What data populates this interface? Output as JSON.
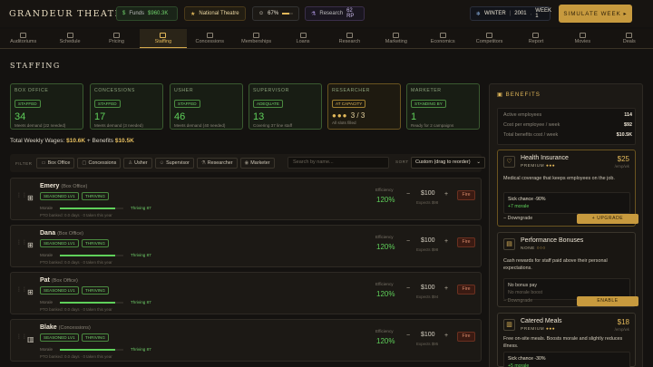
{
  "app": {
    "title": "GRANDEUR THEATRE",
    "simulate_label": "SIMULATE WEEK ▸"
  },
  "topbar": {
    "funds_label": "Funds",
    "funds_value": "$960.3K",
    "theatre_label": "National Theatre",
    "happiness_value": "67%",
    "happiness_level": 0.67,
    "research_label": "Research",
    "research_value": "62 RP",
    "season": "WINTER",
    "year": "2001",
    "week": "WEEK 1"
  },
  "nav": [
    "Auditoriums",
    "Schedule",
    "Pricing",
    "Staffing",
    "Concessions",
    "Memberships",
    "Loans",
    "Research",
    "Marketing",
    "Economics",
    "Competitors",
    "Report",
    "Movies",
    "Deals"
  ],
  "page_title": "STAFFING",
  "cards": [
    {
      "title": "BOX OFFICE",
      "badge": "STAFFED",
      "value": "34",
      "sub": "Meets demand (22 needed)"
    },
    {
      "title": "CONCESSIONS",
      "badge": "STAFFED",
      "value": "17",
      "sub": "Meets demand (3 needed)"
    },
    {
      "title": "USHER",
      "badge": "STAFFED",
      "value": "46",
      "sub": "Meets demand (40 needed)"
    },
    {
      "title": "SUPERVISOR",
      "badge": "ADEQUATE",
      "value": "13",
      "sub": "Covering 37 line staff"
    },
    {
      "title": "RESEARCHER",
      "badge": "AT CAPACITY",
      "value": "3 / 3",
      "sub": "All slots filled"
    },
    {
      "title": "MARKETER",
      "badge": "STANDING BY",
      "value": "1",
      "sub": "Ready for 2 campaigns"
    }
  ],
  "wages": {
    "label": "Total Weekly Wages:",
    "value": "$10.6K",
    "benefits_label": "+ Benefits",
    "benefits_value": "$10.5K"
  },
  "filter": {
    "label": "FILTER",
    "pills": [
      "Box Office",
      "Concessions",
      "Usher",
      "Supervisor",
      "Researcher",
      "Marketer"
    ],
    "search_placeholder": "Search by name...",
    "sort_label": "SORT",
    "sort_value": "Custom (drag to reorder)"
  },
  "staff": [
    {
      "name": "Emery",
      "role": "(Box Office)",
      "level": "SEASONED LV1",
      "mood": "THRIVING",
      "morale_label": "Morale",
      "morale_text": "Thriving 87",
      "morale_level": 0.87,
      "pto": "PTO banked: 0.0 days · 0 taken this year",
      "eff_label": "Efficiency",
      "eff": "120%",
      "pay": "$100",
      "expects": "Expects $98",
      "fire": "Fire"
    },
    {
      "name": "Dana",
      "role": "(Box Office)",
      "level": "SEASONED LV1",
      "mood": "THRIVING",
      "morale_label": "Morale",
      "morale_text": "Thriving 87",
      "morale_level": 0.87,
      "pto": "PTO banked: 0.0 days · 0 taken this year",
      "eff_label": "Efficiency",
      "eff": "120%",
      "pay": "$100",
      "expects": "Expects $98",
      "fire": "Fire"
    },
    {
      "name": "Pat",
      "role": "(Box Office)",
      "level": "SEASONED LV1",
      "mood": "THRIVING",
      "morale_label": "Morale",
      "morale_text": "Thriving 87",
      "morale_level": 0.87,
      "pto": "PTO banked: 0.0 days · 0 taken this year",
      "eff_label": "Efficiency",
      "eff": "120%",
      "pay": "$100",
      "expects": "Expects $94",
      "fire": "Fire"
    },
    {
      "name": "Blake",
      "role": "(Concessions)",
      "level": "SEASONED LV1",
      "mood": "THRIVING",
      "morale_label": "Morale",
      "morale_text": "Thriving 87",
      "morale_level": 0.87,
      "pto": "PTO banked: 0.0 days · 0 taken this year",
      "eff_label": "Efficiency",
      "eff": "120%",
      "pay": "$100",
      "expects": "Expects $95",
      "fire": "Fire"
    }
  ],
  "benefits": {
    "title": "BENEFITS",
    "stats": [
      {
        "label": "Active employees",
        "value": "114"
      },
      {
        "label": "Cost per employee / week",
        "value": "$92"
      },
      {
        "label": "Total benefits cost / week",
        "value": "$10.5K"
      }
    ],
    "items": [
      {
        "name": "Health Insurance",
        "level": "PREMIUM",
        "stars": "●●●",
        "price": "$25",
        "per": "/emp/wk",
        "desc": "Medical coverage that keeps employees on the job.",
        "detail1": "Sick chance -90%",
        "detail2": "+7 morale",
        "down": "− Downgrade",
        "up": "+ UPGRADE"
      },
      {
        "name": "Performance Bonuses",
        "level": "NONE",
        "stars": "○○○",
        "price": "",
        "per": "",
        "desc": "Cash rewards for staff paid above their personal expectations.",
        "detail1": "No bonus pay",
        "detail2": "No morale boost",
        "down": "− Downgrade",
        "up": "ENABLE"
      },
      {
        "name": "Catered Meals",
        "level": "PREMIUM",
        "stars": "●●●",
        "price": "$18",
        "per": "/emp/wk",
        "desc": "Free on-site meals. Boosts morale and slightly reduces illness.",
        "detail1": "Sick chance -30%",
        "detail2": "+5 morale",
        "down": "",
        "up": ""
      }
    ]
  }
}
